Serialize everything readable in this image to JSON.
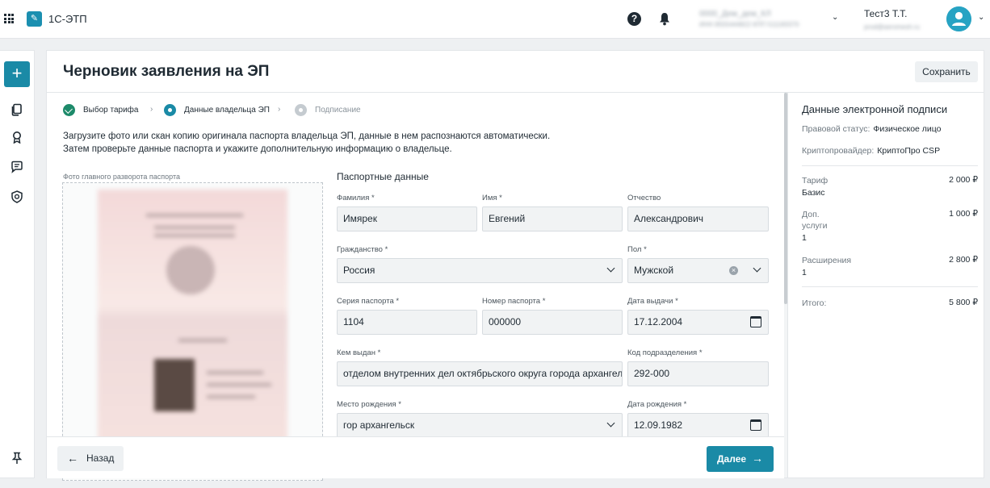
{
  "header": {
    "app_title": "1С-ЭТП",
    "org_name": "0000_Дем_дем_КЛ",
    "org_sub": "ИНН 8555444822 КПП 511183370",
    "user_name": "Тест3 Т.Т.",
    "user_sub": "prod@aeromesh.ru"
  },
  "page": {
    "title": "Черновик заявления на ЭП",
    "save_label": "Сохранить"
  },
  "stepper": {
    "steps": [
      {
        "label": "Выбор тарифа",
        "state": "done"
      },
      {
        "label": "Данные владельца ЭП",
        "state": "active"
      },
      {
        "label": "Подписание",
        "state": "pending"
      }
    ]
  },
  "instructions": {
    "line1": "Загрузите фото или скан копию оригинала паспорта владельца ЭП, данные в нем распознаются автоматически.",
    "line2": "Затем проверьте данные паспорта и укажите дополнительную информацию о владельце."
  },
  "photo": {
    "label": "Фото главного разворота паспорта"
  },
  "form": {
    "section_title": "Паспортные данные",
    "last_name": {
      "label": "Фамилия *",
      "value": "Имярек"
    },
    "first_name": {
      "label": "Имя *",
      "value": "Евгений"
    },
    "patronymic": {
      "label": "Отчество",
      "value": "Александрович"
    },
    "citizenship": {
      "label": "Гражданство *",
      "value": "Россия"
    },
    "gender": {
      "label": "Пол *",
      "value": "Мужской"
    },
    "passport_series": {
      "label": "Серия паспорта *",
      "value": "1104"
    },
    "passport_number": {
      "label": "Номер паспорта *",
      "value": "000000"
    },
    "issue_date": {
      "label": "Дата выдачи *",
      "value": "17.12.2004"
    },
    "issued_by": {
      "label": "Кем выдан *",
      "value": "отделом внутренних дел октябрьского округа города архангельска"
    },
    "division_code": {
      "label": "Код подразделения *",
      "value": "292-000"
    },
    "birth_place": {
      "label": "Место рождения *",
      "value": "гор архангельск"
    },
    "birth_date": {
      "label": "Дата рождения *",
      "value": "12.09.1982"
    }
  },
  "actions": {
    "back_label": "Назад",
    "next_label": "Далее"
  },
  "summary": {
    "title": "Данные электронной подписи",
    "legal_status_key": "Правовой статус:",
    "legal_status_value": "Физическое лицо",
    "crypto_key": "Криптопровайдер:",
    "crypto_value": "КриптоПро CSP",
    "tariff": {
      "name": "Тариф",
      "sub": "Базис",
      "price": "2 000 ₽"
    },
    "extra": {
      "name1": "Доп.",
      "name2": "услуги",
      "sub": "1",
      "price": "1 000 ₽"
    },
    "extensions": {
      "name": "Расширения",
      "sub": "1",
      "price": "2 800 ₽"
    },
    "total": {
      "name": "Итого:",
      "price": "5 800 ₽"
    }
  },
  "colors": {
    "accent": "#1a8aa6",
    "done": "#1d8a6a",
    "pending": "#c5cbd0"
  }
}
